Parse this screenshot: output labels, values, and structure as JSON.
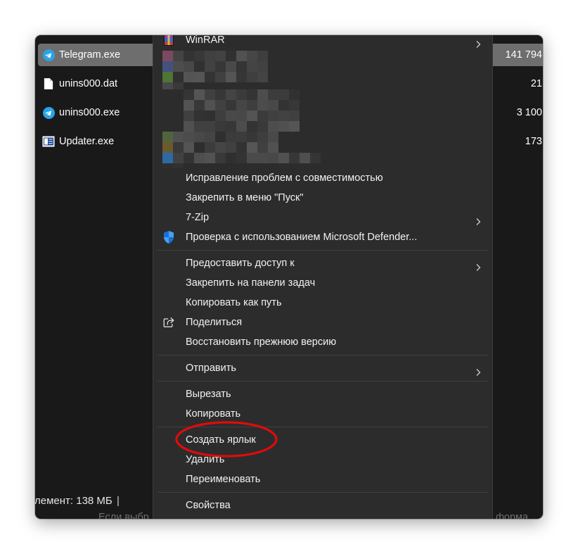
{
  "colors": {
    "page_bg": "#ffffff",
    "window_bg": "#191919",
    "menu_bg": "#2c2c2c",
    "selection": "#6e6e6e",
    "text": "#f2f2f2",
    "annotation": "#e00b0b",
    "telegram_blue": "#2aa3e4"
  },
  "file_list": {
    "rows": [
      {
        "name": "Telegram.exe",
        "size": "141 794",
        "icon": "telegram-icon",
        "selected": true
      },
      {
        "name": "unins000.dat",
        "size": "21",
        "icon": "document-icon",
        "selected": false
      },
      {
        "name": "unins000.exe",
        "size": "3 100",
        "icon": "telegram-icon",
        "selected": false
      },
      {
        "name": "Updater.exe",
        "size": "173",
        "icon": "app-window-icon",
        "selected": false
      }
    ]
  },
  "status_bar": {
    "selection_info": "лемент: 138 МБ",
    "divider": "|"
  },
  "details_hint": {
    "left_text": "Если выбр",
    "right_text": "форма"
  },
  "context_menu": {
    "top": {
      "label": "WinRAR",
      "icon": "winrar-icon",
      "has_submenu": true
    },
    "group_compat": [
      {
        "label": "Исправление проблем с совместимостью"
      },
      {
        "label": "Закрепить в меню \"Пуск\""
      },
      {
        "label": "7-Zip",
        "has_submenu": true
      },
      {
        "label": "Проверка с использованием Microsoft Defender...",
        "icon": "defender-shield-icon"
      }
    ],
    "group_share": [
      {
        "label": "Предоставить доступ к",
        "has_submenu": true
      },
      {
        "label": "Закрепить на панели задач"
      },
      {
        "label": "Копировать как путь"
      },
      {
        "label": "Поделиться",
        "icon": "share-icon"
      },
      {
        "label": "Восстановить прежнюю версию"
      }
    ],
    "group_send": [
      {
        "label": "Отправить",
        "has_submenu": true
      }
    ],
    "group_clipboard": [
      {
        "label": "Вырезать"
      },
      {
        "label": "Копировать"
      }
    ],
    "group_manage": [
      {
        "label": "Создать ярлык",
        "circled_in_red": true
      },
      {
        "label": "Удалить"
      },
      {
        "label": "Переименовать"
      }
    ],
    "group_props": [
      {
        "label": "Свойства"
      }
    ]
  }
}
